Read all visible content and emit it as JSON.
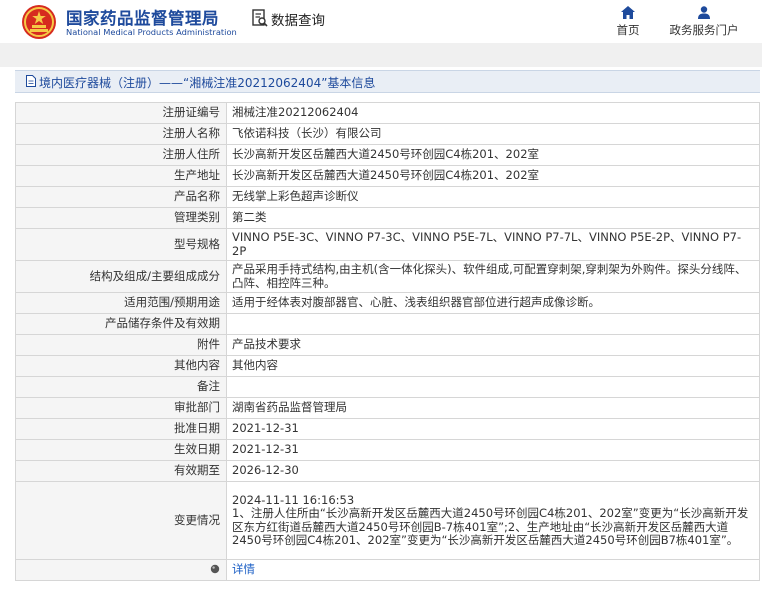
{
  "header": {
    "agency_cn": "国家药品监督管理局",
    "agency_en": "National Medical Products Administration",
    "query_label": "数据查询",
    "nav": [
      {
        "icon": "home-icon",
        "label": "首页"
      },
      {
        "icon": "user-icon",
        "label": "政务服务门户"
      }
    ]
  },
  "breadcrumb": {
    "section": "境内医疗器械（注册）",
    "separator": "——",
    "detail": "“湘械注准20212062404”基本信息"
  },
  "rows": [
    {
      "key": "注册证编号",
      "value": "湘械注准20212062404"
    },
    {
      "key": "注册人名称",
      "value": "飞依诺科技（长沙）有限公司"
    },
    {
      "key": "注册人住所",
      "value": "长沙高新开发区岳麓西大道2450号环创园C4栋201、202室"
    },
    {
      "key": "生产地址",
      "value": "长沙高新开发区岳麓西大道2450号环创园C4栋201、202室"
    },
    {
      "key": "产品名称",
      "value": "无线掌上彩色超声诊断仪"
    },
    {
      "key": "管理类别",
      "value": "第二类"
    },
    {
      "key": "型号规格",
      "value": "VINNO P5E-3C、VINNO P7-3C、VINNO P5E-7L、VINNO P7-7L、VINNO P5E-2P、VINNO P7-2P"
    },
    {
      "key": "结构及组成/主要组成成分",
      "value": "产品采用手持式结构,由主机(含一体化探头)、软件组成,可配置穿刺架,穿刺架为外购件。探头分线阵、凸阵、相控阵三种。"
    },
    {
      "key": "适用范围/预期用途",
      "value": "适用于经体表对腹部器官、心脏、浅表组织器官部位进行超声成像诊断。"
    },
    {
      "key": "产品储存条件及有效期",
      "value": ""
    },
    {
      "key": "附件",
      "value": "产品技术要求"
    },
    {
      "key": "其他内容",
      "value": "其他内容"
    },
    {
      "key": "备注",
      "value": ""
    },
    {
      "key": "审批部门",
      "value": "湖南省药品监督管理局"
    },
    {
      "key": "批准日期",
      "value": "2021-12-31"
    },
    {
      "key": "生效日期",
      "value": "2021-12-31"
    },
    {
      "key": "有效期至",
      "value": "2026-12-30"
    },
    {
      "key": "变更情况",
      "value_time": "2024-11-11 16:16:53",
      "value": "1、注册人住所由“长沙高新开发区岳麓西大道2450号环创园C4栋201、202室”变更为“长沙高新开发区东方红街道岳麓西大道2450号环创园B-7栋401室”;2、生产地址由“长沙高新开发区岳麓西大道2450号环创园C4栋201、202室”变更为“长沙高新开发区岳麓西大道2450号环创园B7栋401室”。"
    },
    {
      "key": "",
      "key_icon": "map-pin-icon",
      "value": "详情"
    }
  ]
}
